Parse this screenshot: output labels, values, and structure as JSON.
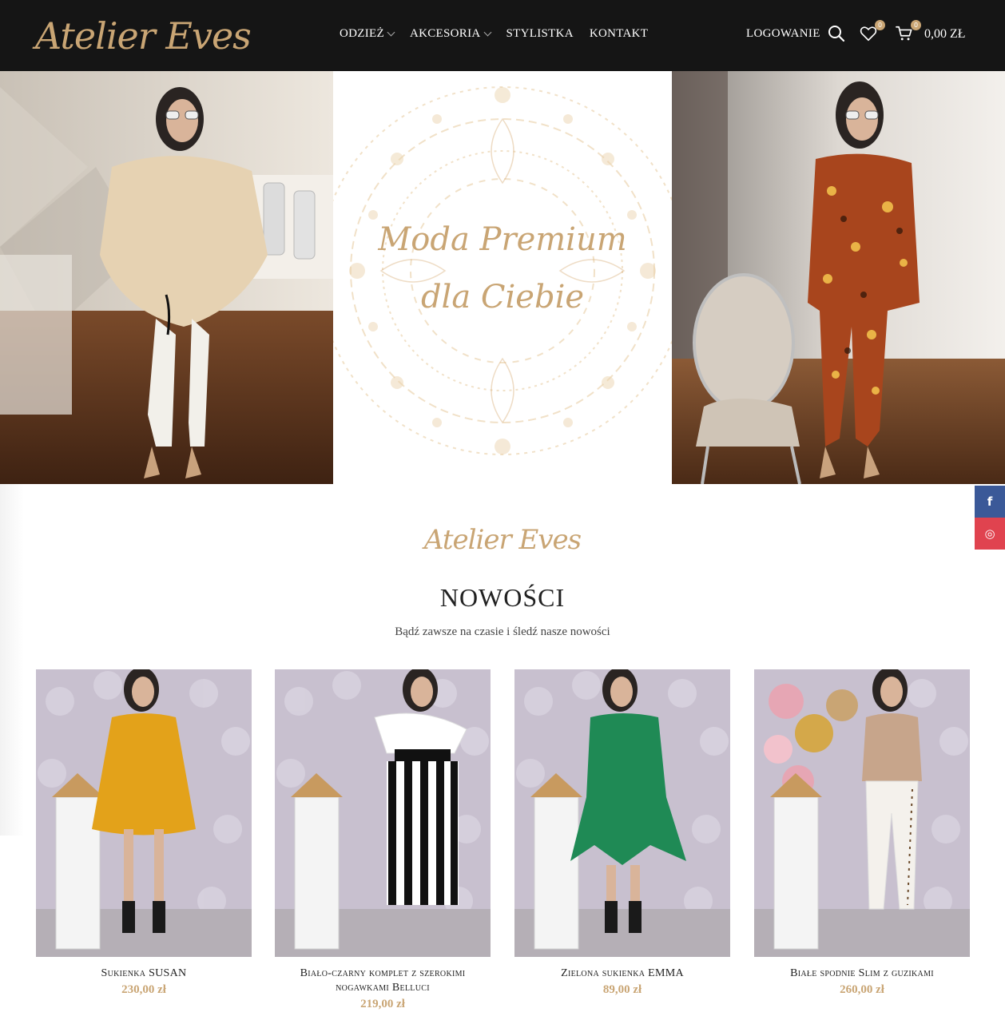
{
  "header": {
    "logo": "Atelier Eves",
    "nav": [
      {
        "label": "ODZIEŻ",
        "has_dropdown": true
      },
      {
        "label": "AKCESORIA",
        "has_dropdown": true
      },
      {
        "label": "STYLISTKA",
        "has_dropdown": false
      },
      {
        "label": "KONTAKT",
        "has_dropdown": false
      }
    ],
    "login_label": "LOGOWANIE",
    "wishlist_count": "0",
    "cart_count": "0",
    "cart_total": "0,00 ZŁ",
    "icons": [
      "search-icon",
      "heart-icon",
      "cart-icon"
    ]
  },
  "hero": {
    "title_line1": "Moda Premium",
    "title_line2": "dla Ciebie"
  },
  "social": [
    {
      "icon": "facebook-icon",
      "glyph": "f",
      "color": "#3b5998"
    },
    {
      "icon": "instagram-icon",
      "glyph": "◎",
      "color": "#e0434f"
    }
  ],
  "section": {
    "logo": "Atelier Eves",
    "title": "NOWOŚCI",
    "subtitle": "Bądź zawsze na czasie i śledź nasze nowości"
  },
  "products": [
    {
      "name": "Sukienka SUSAN",
      "price": "230,00 zł",
      "outfit_color": "#e3a21a"
    },
    {
      "name": "Biało-czarny komplet z szerokimi nogawkami Belluci",
      "price": "219,00 zł",
      "outfit_color": "#111111"
    },
    {
      "name": "Zielona sukienka EMMA",
      "price": "89,00 zł",
      "outfit_color": "#1f8a55"
    },
    {
      "name": "Białe spodnie Slim z guzikami",
      "price": "260,00 zł",
      "outfit_color": "#f4f1ec"
    }
  ],
  "colors": {
    "accent": "#c9a574",
    "header_bg": "#151515"
  }
}
